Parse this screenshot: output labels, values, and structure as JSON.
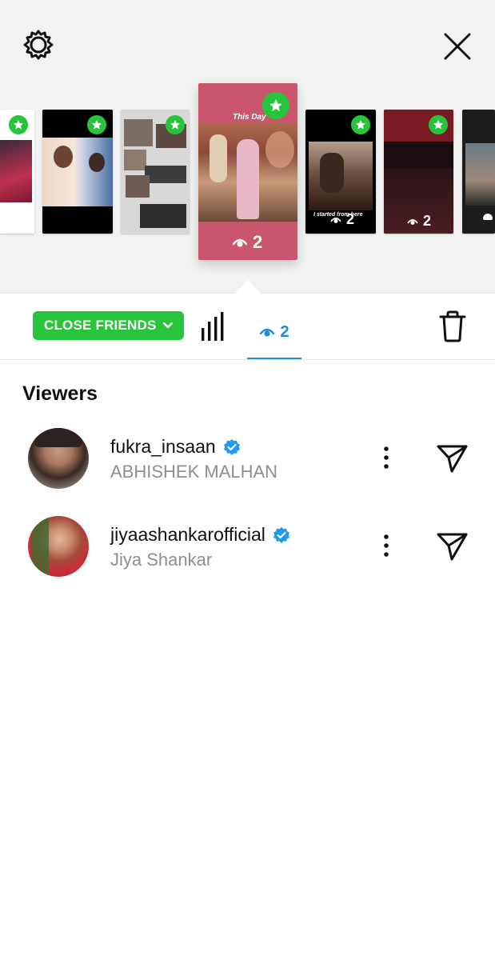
{
  "header": {
    "settings_icon": "gear-icon",
    "close_icon": "close-icon"
  },
  "stories": [
    {
      "badge": "star-icon",
      "count": ""
    },
    {
      "badge": "star-icon",
      "count": ""
    },
    {
      "badge": "star-icon",
      "count": ""
    },
    {
      "caption": "This Day",
      "badge": "star-icon",
      "count": "2",
      "selected": true
    },
    {
      "caption": "I started from here",
      "badge": "star-icon",
      "count": "2"
    },
    {
      "badge": "star-icon",
      "count": "2"
    },
    {
      "badge": "",
      "count": ""
    }
  ],
  "tabs": {
    "audience_label": "CLOSE FRIENDS",
    "views_count": "2"
  },
  "viewers_title": "Viewers",
  "viewers": [
    {
      "username": "fukra_insaan",
      "full_name": "ABHISHEK MALHAN",
      "verified": true
    },
    {
      "username": "jiyaashankarofficial",
      "full_name": "Jiya Shankar",
      "verified": true
    }
  ],
  "colors": {
    "close_friends_green": "#28c43c",
    "accent_blue": "#1a8cd8",
    "verified_blue": "#1d9bf0"
  }
}
